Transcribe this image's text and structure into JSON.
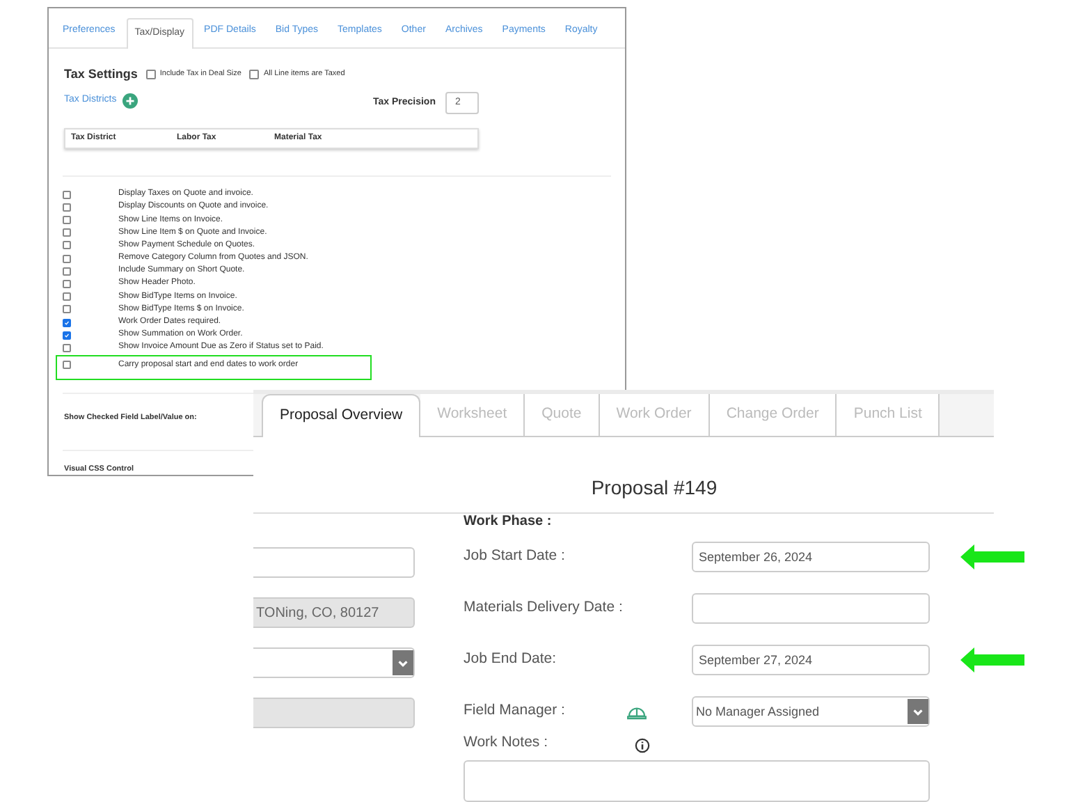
{
  "settings_window": {
    "tabs": [
      {
        "label": "Preferences",
        "selected": false
      },
      {
        "label": "Tax/Display",
        "selected": true
      },
      {
        "label": "PDF Details",
        "selected": false
      },
      {
        "label": "Bid Types",
        "selected": false
      },
      {
        "label": "Templates",
        "selected": false
      },
      {
        "label": "Other",
        "selected": false
      },
      {
        "label": "Archives",
        "selected": false
      },
      {
        "label": "Payments",
        "selected": false
      },
      {
        "label": "Royalty",
        "selected": false
      }
    ],
    "tax_settings": {
      "title": "Tax Settings",
      "options": [
        {
          "label": "Include Tax in Deal Size",
          "checked": false
        },
        {
          "label": "All Line items are Taxed",
          "checked": false
        }
      ]
    },
    "tax_districts_link": "Tax Districts",
    "tax_precision": {
      "label": "Tax Precision",
      "value": "2"
    },
    "table": {
      "columns": [
        "Tax District",
        "Labor Tax",
        "Material Tax"
      ]
    },
    "display_options": [
      {
        "label": "Display Taxes on Quote and invoice.",
        "checked": false,
        "highlighted": false
      },
      {
        "label": "Display Discounts on Quote and invoice.",
        "checked": false,
        "highlighted": false
      },
      {
        "label": "Show Line Items on Invoice.",
        "checked": false,
        "highlighted": false
      },
      {
        "label": "Show Line Item $ on Quote and Invoice.",
        "checked": false,
        "highlighted": false
      },
      {
        "label": "Show Payment Schedule on Quotes.",
        "checked": false,
        "highlighted": false
      },
      {
        "label": "Remove Category Column from Quotes and JSON.",
        "checked": false,
        "highlighted": false
      },
      {
        "label": "Include Summary on Short Quote.",
        "checked": false,
        "highlighted": false
      },
      {
        "label": "Show Header Photo.",
        "checked": false,
        "highlighted": false
      },
      {
        "label": "Show BidType Items on Invoice.",
        "checked": false,
        "highlighted": false
      },
      {
        "label": "Show BidType Items $ on Invoice.",
        "checked": false,
        "highlighted": false
      },
      {
        "label": "Work Order Dates required.",
        "checked": true,
        "highlighted": false
      },
      {
        "label": "Show Summation on Work Order.",
        "checked": true,
        "highlighted": false
      },
      {
        "label": "Show Invoice Amount Due as Zero if Status set to Paid.",
        "checked": false,
        "highlighted": false
      },
      {
        "label": "Carry proposal start and end dates to work order",
        "checked": false,
        "highlighted": true
      }
    ],
    "sections": [
      "Show Checked Field Label/Value on:",
      "Visual CSS Control"
    ]
  },
  "proposal_window": {
    "tabs": [
      {
        "label": "Proposal Overview",
        "selected": true
      },
      {
        "label": "Worksheet",
        "selected": false
      },
      {
        "label": "Quote",
        "selected": false
      },
      {
        "label": "Work Order",
        "selected": false
      },
      {
        "label": "Change Order",
        "selected": false
      },
      {
        "label": "Punch List",
        "selected": false
      }
    ],
    "title": "Proposal #149",
    "left_fields": [
      {
        "kind": "text",
        "disabled": false
      },
      {
        "kind": "text",
        "disabled": true,
        "value": "TONing, CO, 80127"
      },
      {
        "kind": "select",
        "disabled": false
      },
      {
        "kind": "text",
        "disabled": true
      }
    ],
    "work_phase": {
      "title": "Work Phase :",
      "rows": [
        {
          "kind": "date",
          "label": "Job Start Date :",
          "value": "September 26, 2024",
          "highlighted": true
        },
        {
          "kind": "date",
          "label": "Materials Delivery Date :",
          "highlighted": false
        },
        {
          "kind": "date",
          "label": "Job End Date:",
          "value": "September 27, 2024",
          "highlighted": true
        },
        {
          "kind": "select",
          "label": "Field Manager :",
          "value": "No Manager Assigned",
          "highlighted": false
        }
      ],
      "notes": {
        "label": "Work Notes :"
      }
    }
  }
}
